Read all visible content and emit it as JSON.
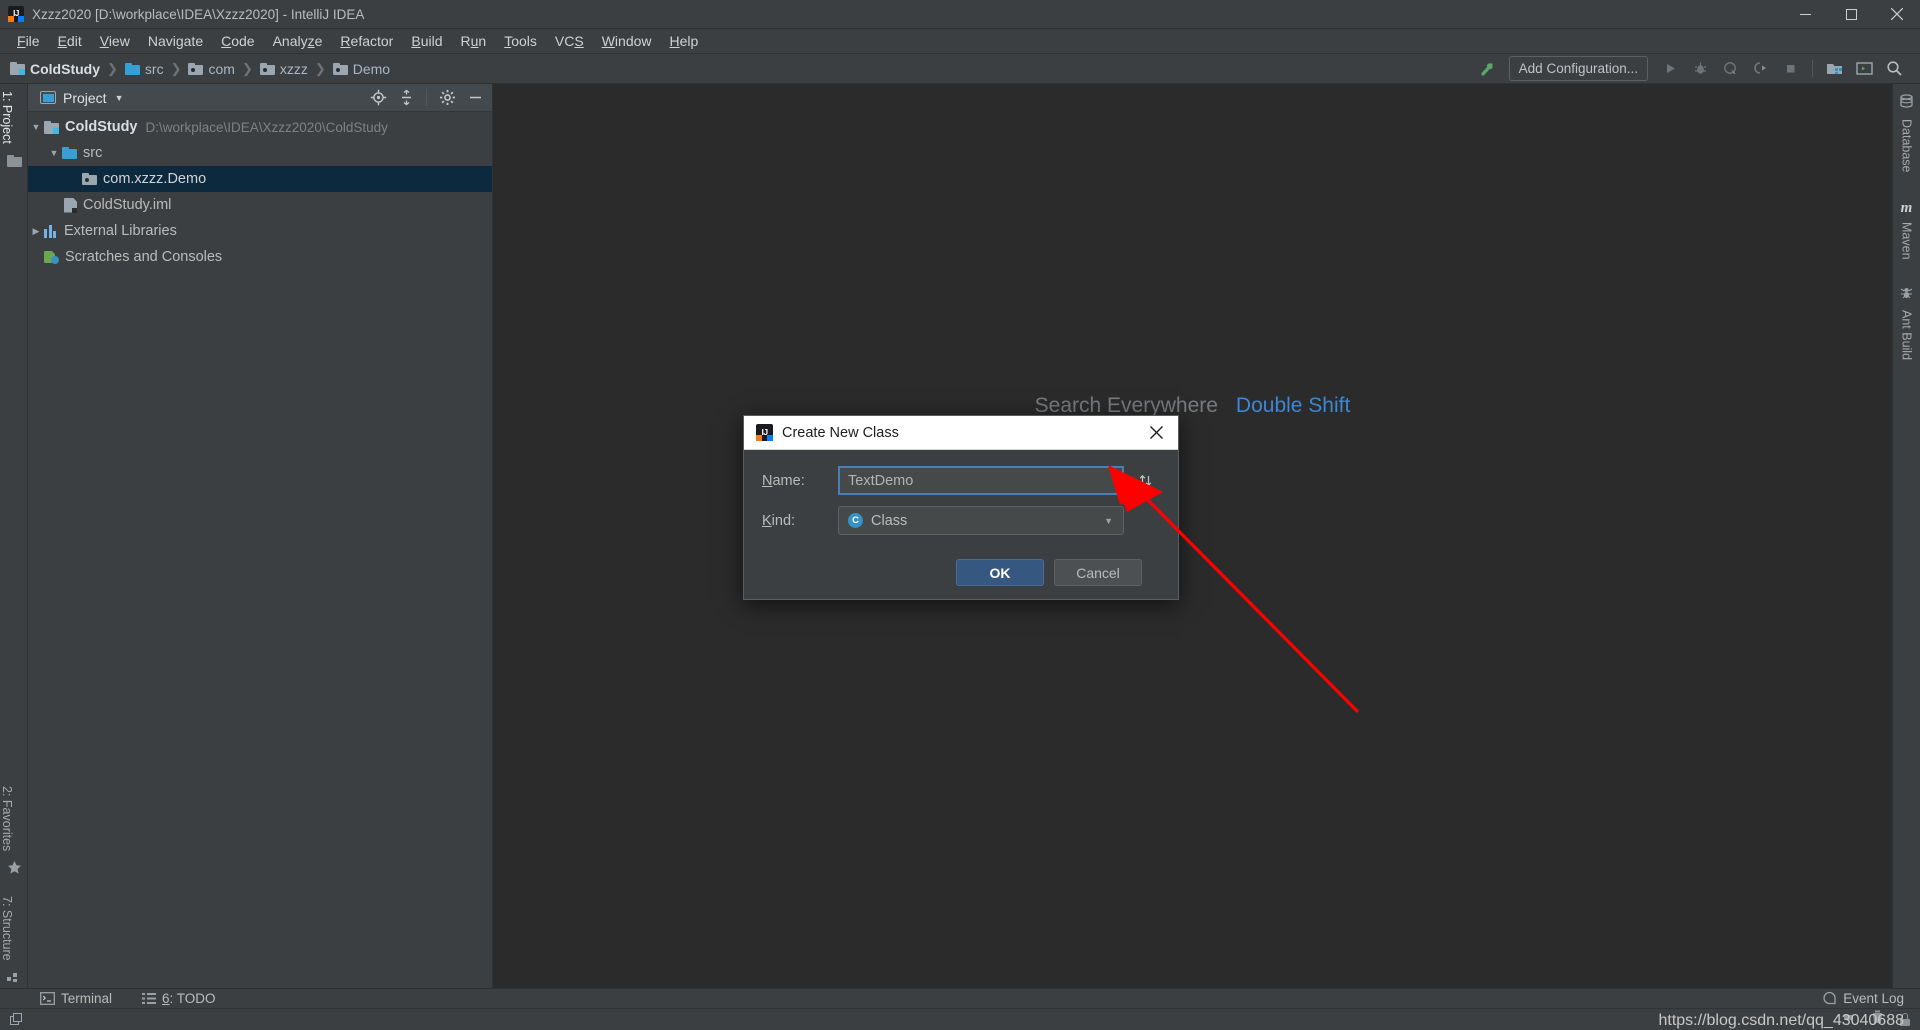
{
  "window": {
    "title": "Xzzz2020 [D:\\workplace\\IDEA\\Xzzz2020] - IntelliJ IDEA",
    "app_icon": "intellij-idea-icon",
    "minimize": "minimize-icon",
    "maximize": "maximize-icon",
    "close": "close-icon"
  },
  "menubar": {
    "items": [
      {
        "label": "File",
        "mnemonic": "F"
      },
      {
        "label": "Edit",
        "mnemonic": "E"
      },
      {
        "label": "View",
        "mnemonic": "V"
      },
      {
        "label": "Navigate",
        "mnemonic": "g"
      },
      {
        "label": "Code",
        "mnemonic": "C"
      },
      {
        "label": "Analyze",
        "mnemonic": "z"
      },
      {
        "label": "Refactor",
        "mnemonic": "R"
      },
      {
        "label": "Build",
        "mnemonic": "B"
      },
      {
        "label": "Run",
        "mnemonic": "u"
      },
      {
        "label": "Tools",
        "mnemonic": "T"
      },
      {
        "label": "VCS",
        "mnemonic": "S"
      },
      {
        "label": "Window",
        "mnemonic": "W"
      },
      {
        "label": "Help",
        "mnemonic": "H"
      }
    ]
  },
  "navbar": {
    "breadcrumbs": [
      {
        "label": "ColdStudy",
        "icon": "module-icon"
      },
      {
        "label": "src",
        "icon": "source-folder-icon"
      },
      {
        "label": "com",
        "icon": "package-folder-icon"
      },
      {
        "label": "xzzz",
        "icon": "package-folder-icon"
      },
      {
        "label": "Demo",
        "icon": "package-folder-icon"
      }
    ],
    "separator": "❯",
    "add_configuration": "Add Configuration...",
    "buttons": [
      "build-hammer-icon",
      "run-icon",
      "debug-icon",
      "run-with-coverage-icon",
      "profile-icon",
      "stop-icon",
      "project-structure-icon",
      "terminal-icon",
      "search-icon"
    ]
  },
  "left_strip": {
    "top": [
      {
        "label": "1: Project",
        "prefix": "1",
        "icon": "project-panel-icon",
        "active": true
      }
    ],
    "bottom": [
      {
        "label": "2: Favorites",
        "prefix": "2",
        "icon": "star-icon"
      },
      {
        "label": "7: Structure",
        "prefix": "7",
        "icon": "structure-icon"
      }
    ]
  },
  "right_strip": {
    "items": [
      {
        "label": "Database",
        "icon": "database-icon"
      },
      {
        "label": "Maven",
        "icon": "maven-m-icon"
      },
      {
        "label": "Ant Build",
        "icon": "ant-icon"
      }
    ]
  },
  "project_panel": {
    "title": "Project",
    "dropdown_arrow": "chevron-down-icon",
    "toolbar": [
      "locate-target-icon",
      "collapse-all-icon",
      "settings-gear-icon",
      "hide-panel-icon"
    ],
    "tree": [
      {
        "label": "ColdStudy",
        "hint": "D:\\workplace\\IDEA\\Xzzz2020\\ColdStudy",
        "icon": "module-icon",
        "indent": 0,
        "arrow": "expanded",
        "bold": true,
        "selected": false
      },
      {
        "label": "src",
        "hint": "",
        "icon": "source-folder-icon",
        "indent": 1,
        "arrow": "expanded",
        "bold": false,
        "selected": false
      },
      {
        "label": "com.xzzz.Demo",
        "hint": "",
        "icon": "package-folder-icon",
        "indent": 2,
        "arrow": "none",
        "bold": false,
        "selected": true
      },
      {
        "label": "ColdStudy.iml",
        "hint": "",
        "icon": "iml-file-icon",
        "indent": 1,
        "arrow": "none",
        "bold": false,
        "selected": false
      },
      {
        "label": "External Libraries",
        "hint": "",
        "icon": "library-icon",
        "indent": 0,
        "arrow": "collapsed",
        "bold": false,
        "selected": false
      },
      {
        "label": "Scratches and Consoles",
        "hint": "",
        "icon": "scratches-icon",
        "indent": 0,
        "arrow": "none",
        "bold": false,
        "selected": false
      }
    ]
  },
  "editor": {
    "hint_label": "Search Everywhere",
    "hint_key": "Double Shift"
  },
  "dialog": {
    "title": "Create New Class",
    "icon": "intellij-idea-icon",
    "close_icon": "close-icon",
    "name_label": "Name:",
    "name_label_mnemonic": "N",
    "name_value": "TextDemo",
    "name_placeholder": "",
    "swap_icon": "swap-arrows-icon",
    "kind_label": "Kind:",
    "kind_label_mnemonic": "K",
    "kind_value": "Class",
    "kind_badge": "C",
    "kind_arrow": "chevron-down-icon",
    "ok_label": "OK",
    "cancel_label": "Cancel"
  },
  "annotation": {
    "arrow_color": "#fe0000",
    "target": "name-input"
  },
  "bottom_strip": {
    "items": [
      {
        "label": "Terminal",
        "icon": "terminal-icon"
      },
      {
        "label": "6: TODO",
        "prefix": "6",
        "icon": "todo-list-icon"
      }
    ],
    "event_log": "Event Log",
    "event_log_icon": "event-log-icon"
  },
  "statusbar": {
    "stack_icon": "window-stack-icon",
    "watermark": "https://blog.csdn.net/qq_43040688"
  },
  "colors": {
    "chrome": "#3c3f41",
    "editor_bg": "#2b2b2b",
    "selection": "#0d293e",
    "accent_blue": "#3e86d6",
    "primary_button": "#365880",
    "annotation_red": "#fe0000"
  }
}
